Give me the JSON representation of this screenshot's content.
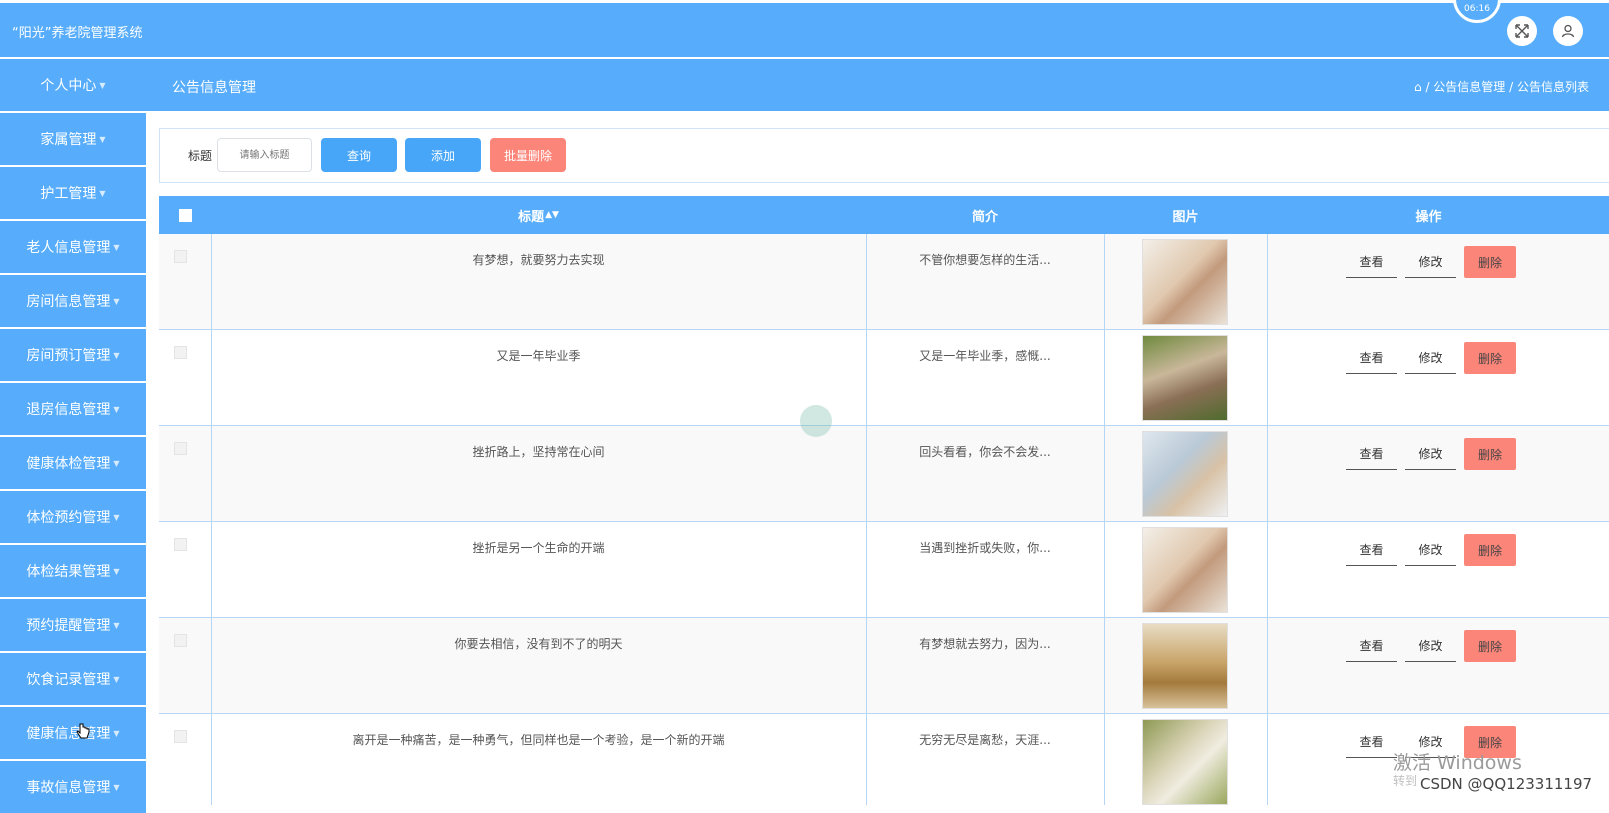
{
  "app": {
    "title": "“阳光”养老院管理系统",
    "timer_text": "06:16",
    "accent": "#57adfb",
    "danger": "#fc8579"
  },
  "sidebar": {
    "items": [
      {
        "label": "个人中心"
      },
      {
        "label": "家属管理"
      },
      {
        "label": "护工管理"
      },
      {
        "label": "老人信息管理"
      },
      {
        "label": "房间信息管理"
      },
      {
        "label": "房间预订管理"
      },
      {
        "label": "退房信息管理"
      },
      {
        "label": "健康体检管理"
      },
      {
        "label": "体检预约管理"
      },
      {
        "label": "体检结果管理"
      },
      {
        "label": "预约提醒管理"
      },
      {
        "label": "饮食记录管理"
      },
      {
        "label": "健康信息管理"
      },
      {
        "label": "事故信息管理"
      }
    ]
  },
  "header": {
    "page_title": "公告信息管理",
    "breadcrumb": "/ 公告信息管理 / 公告信息列表"
  },
  "search": {
    "label": "标题",
    "placeholder": "请输入标题",
    "query_label": "查询",
    "add_label": "添加",
    "batch_delete_label": "批量删除"
  },
  "table": {
    "columns": [
      "标题",
      "简介",
      "图片",
      "操作"
    ],
    "sort_icon": "sort-icon",
    "actions": {
      "view": "查看",
      "edit": "修改",
      "delete": "删除"
    },
    "rows": [
      {
        "title": "有梦想，就要努力去实现",
        "intro": "不管你想要怎样的生活...",
        "image": "elderly-group-photo"
      },
      {
        "title": "又是一年毕业季",
        "intro": "又是一年毕业季，感慨...",
        "image": "elderly-women-photo"
      },
      {
        "title": "挫折路上，坚持常在心间",
        "intro": "回头看看，你会不会发...",
        "image": "nurse-care-photo"
      },
      {
        "title": "挫折是另一个生命的开端",
        "intro": "当遇到挫折或失败，你...",
        "image": "elderly-group-photo"
      },
      {
        "title": "你要去相信，没有到不了的明天",
        "intro": "有梦想就去努力，因为...",
        "image": "coins-figurine-photo"
      },
      {
        "title": "离开是一种痛苦，是一种勇气，但同样也是一个考验，是一个新的开端",
        "intro": "无穷无尽是离愁，天涯...",
        "image": "elderly-couple-photo"
      }
    ]
  },
  "overlay": {
    "watermark": "激活 Windows",
    "watermark_sub": "转到",
    "csdn": "CSDN @QQ123311197"
  }
}
